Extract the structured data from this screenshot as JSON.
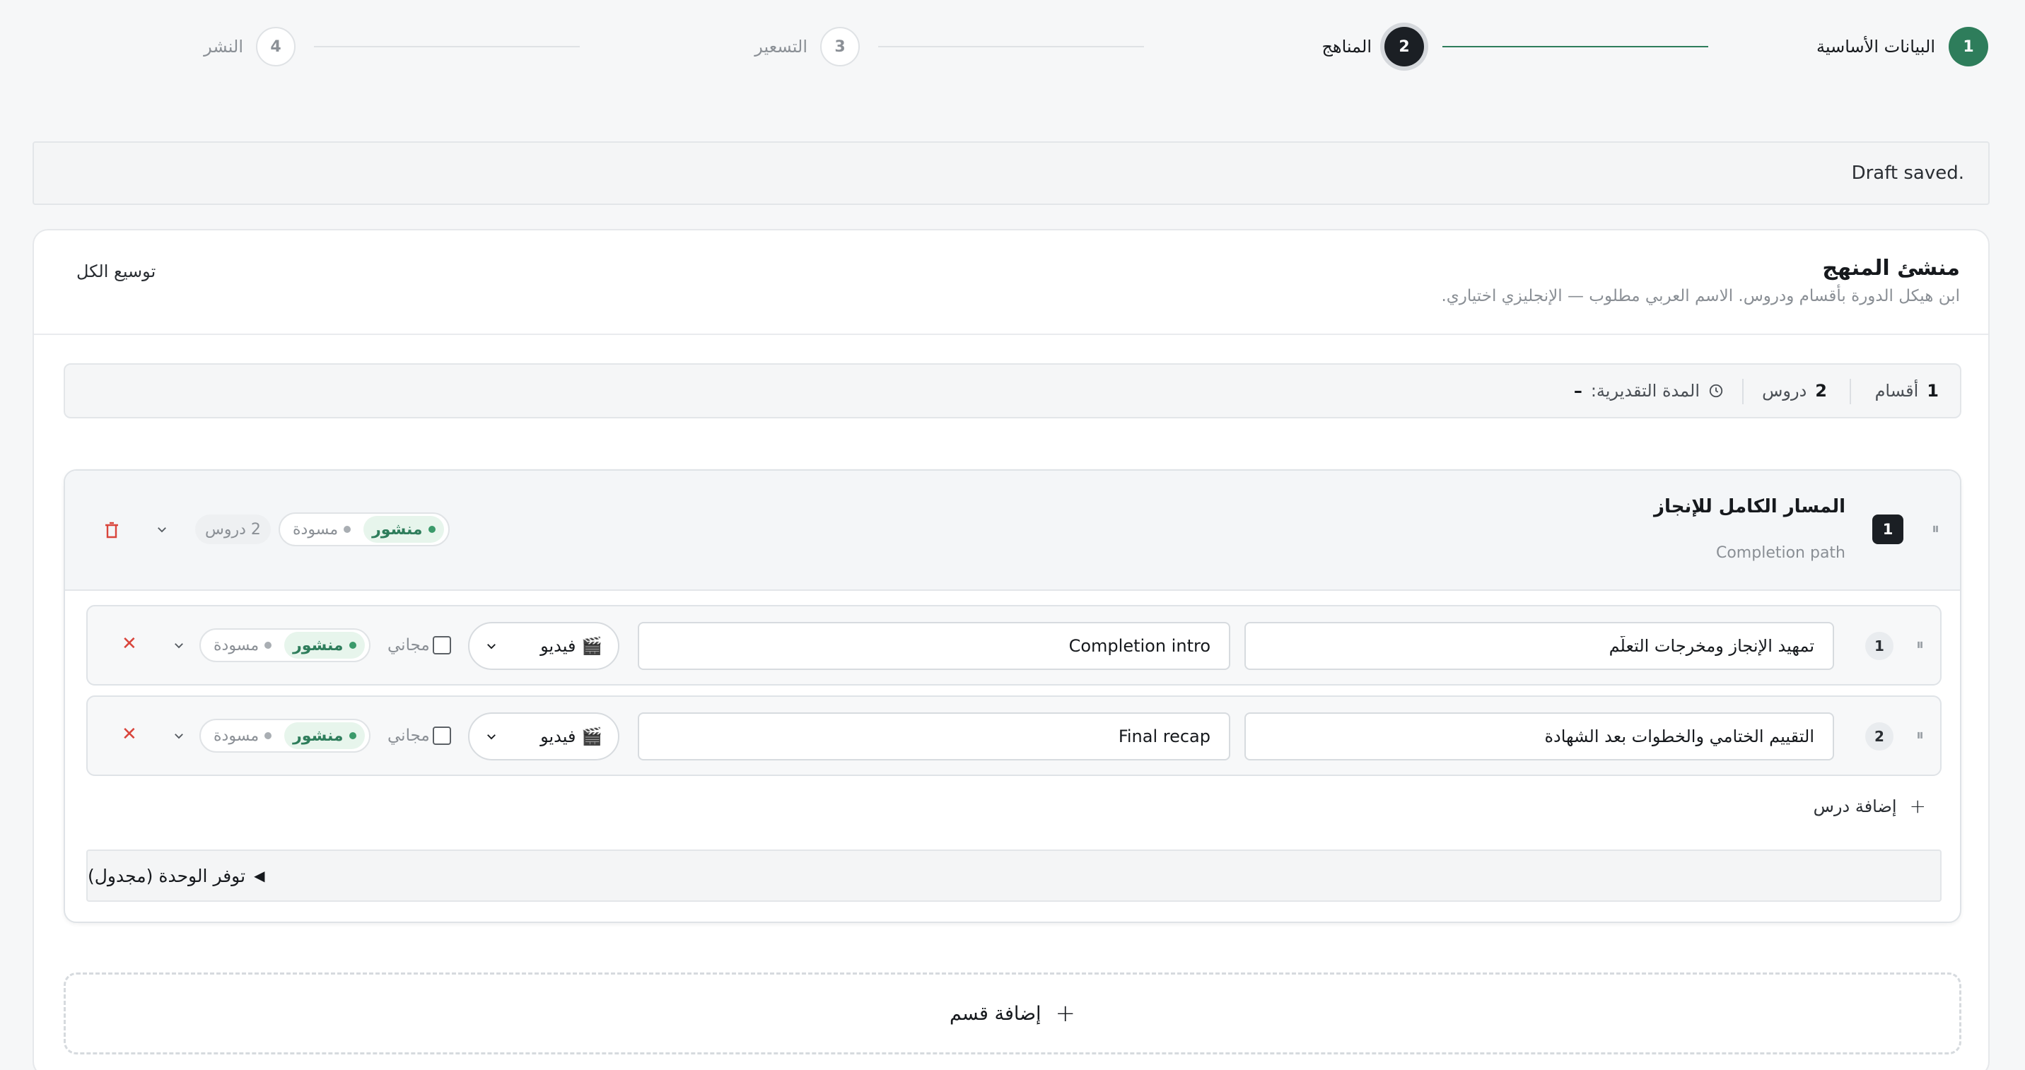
{
  "stepper": {
    "steps": [
      {
        "number": "1",
        "label": "البيانات الأساسية",
        "state": "done"
      },
      {
        "number": "2",
        "label": "المناهج",
        "state": "active"
      },
      {
        "number": "3",
        "label": "التسعير",
        "state": "todo"
      },
      {
        "number": "4",
        "label": "النشر",
        "state": "todo"
      }
    ]
  },
  "draft_notice": "Draft saved.",
  "builder": {
    "title": "منشئ المنهج",
    "subtitle": "ابن هيكل الدورة بأقسام ودروس. الاسم العربي مطلوب — الإنجليزي اختياري.",
    "expand_all": "توسيع الكل",
    "stats": {
      "sections_count": "1",
      "sections_label": "أقسام",
      "lessons_count": "2",
      "lessons_label": "دروس",
      "duration_label": "المدة التقديرية:",
      "duration_value": "–"
    }
  },
  "section": {
    "number": "1",
    "title_ar": "المسار الكامل للإنجاز",
    "title_en": "Completion path",
    "lesson_count_chip": "2 دروس",
    "status_published": "منشور",
    "status_draft": "مسودة",
    "lessons": [
      {
        "number": "1",
        "title_ar": "تمهيد الإنجاز ومخرجات التعلّم",
        "title_en": "Completion intro",
        "type": "🎬 فيديو",
        "free_label": "مجاني",
        "status_published": "منشور",
        "status_draft": "مسودة"
      },
      {
        "number": "2",
        "title_ar": "التقييم الختامي والخطوات بعد الشهادة",
        "title_en": "Final recap",
        "type": "🎬 فيديو",
        "free_label": "مجاني",
        "status_published": "منشور",
        "status_draft": "مسودة"
      }
    ],
    "add_lesson": "إضافة درس",
    "availability": "توفر الوحدة (مجدول)",
    "availability_marker": "◀"
  },
  "add_section": "إضافة قسم",
  "icons": {
    "drag": "drag-handle-icon",
    "clock": "clock-icon",
    "chevron": "chevron-down-icon",
    "trash": "trash-icon",
    "remove": "close-icon",
    "plus": "plus-icon"
  },
  "colors": {
    "success": "#2e7d5b",
    "dark": "#1b1f24",
    "danger": "#d9453c"
  }
}
